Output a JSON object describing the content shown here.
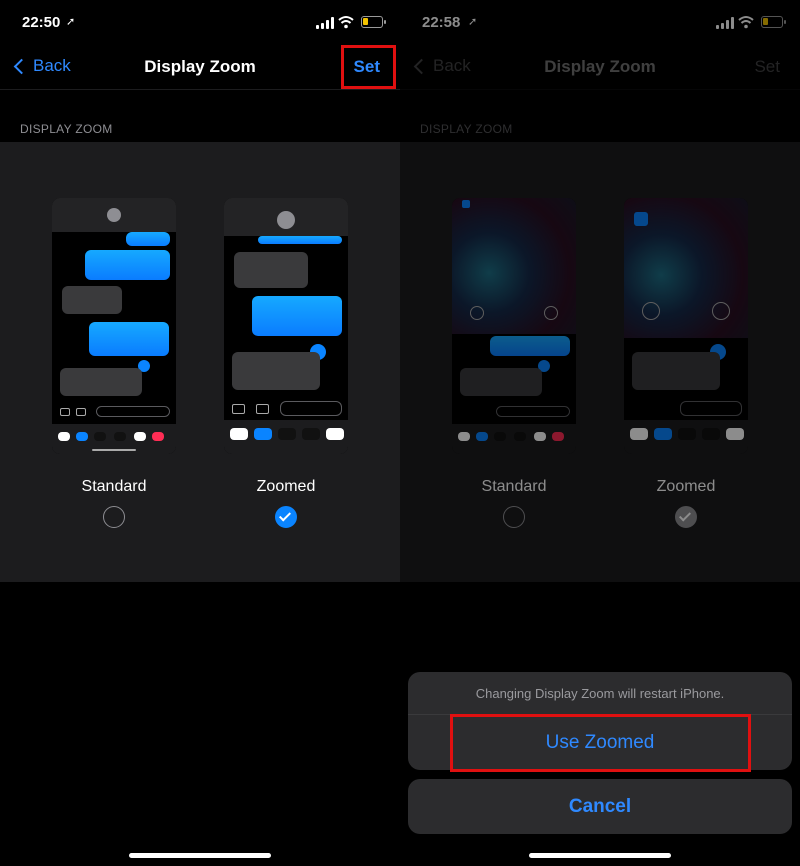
{
  "left": {
    "status": {
      "time": "22:50"
    },
    "nav": {
      "back": "Back",
      "title": "Display Zoom",
      "action": "Set"
    },
    "section_label": "DISPLAY ZOOM",
    "options": [
      {
        "label": "Standard",
        "selected": false
      },
      {
        "label": "Zoomed",
        "selected": true
      }
    ]
  },
  "right": {
    "status": {
      "time": "22:58"
    },
    "nav": {
      "back": "Back",
      "title": "Display Zoom",
      "action": "Set"
    },
    "section_label": "DISPLAY ZOOM",
    "options": [
      {
        "label": "Standard",
        "selected": false
      },
      {
        "label": "Zoomed",
        "selected": true
      }
    ],
    "sheet": {
      "message": "Changing Display Zoom will restart iPhone.",
      "confirm": "Use Zoomed",
      "cancel": "Cancel"
    }
  },
  "colors": {
    "accent": "#2f89ff",
    "highlight": "#e01010",
    "battery": "#f2c300"
  }
}
